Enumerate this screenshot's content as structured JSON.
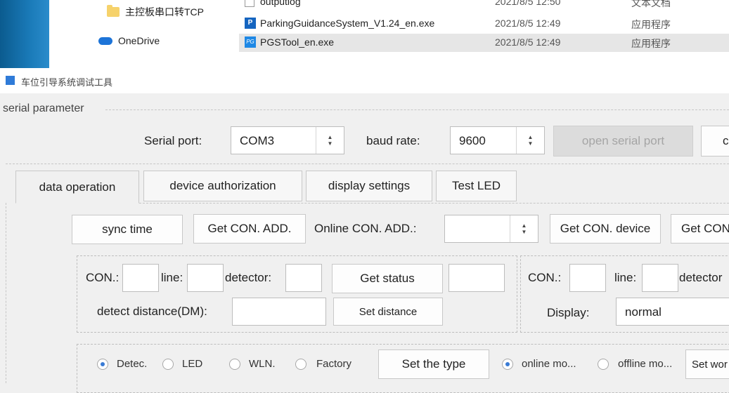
{
  "explorer": {
    "nav": [
      {
        "label": "主控板串口转TCP",
        "icon": "folder-icon"
      },
      {
        "label": "OneDrive",
        "icon": "cloud-icon"
      }
    ],
    "files": [
      {
        "name": "outputlog",
        "date": "2021/8/5 12:50",
        "type": "文本文档"
      },
      {
        "name": "ParkingGuidanceSystem_V1.24_en.exe",
        "date": "2021/8/5 12:49",
        "type": "应用程序"
      },
      {
        "name": "PGSTool_en.exe",
        "date": "2021/8/5 12:49",
        "type": "应用程序",
        "selected": true
      }
    ]
  },
  "app": {
    "title": "车位引导系统调试工具",
    "serial_group": "serial parameter",
    "serial_port_label": "Serial port:",
    "serial_port_value": "COM3",
    "baud_label": "baud rate:",
    "baud_value": "9600",
    "open_button": "open serial port",
    "next_button_fragment": "c"
  },
  "tabs": [
    {
      "label": "data operation",
      "active": true
    },
    {
      "label": "device authorization"
    },
    {
      "label": "display settings"
    },
    {
      "label": "Test LED"
    }
  ],
  "toolbar": {
    "sync_time": "sync time",
    "get_con_add": "Get CON. ADD.",
    "online_label": "Online CON. ADD.:",
    "online_value": "",
    "get_con_device": "Get CON. device",
    "get_con_fragment": "Get CON"
  },
  "left_box": {
    "con_label": "CON.:",
    "line_label": "line:",
    "detector_label": "detector:",
    "get_status": "Get status",
    "distance_label": "detect distance(DM):",
    "set_distance": "Set distance"
  },
  "right_box": {
    "con_label": "CON.:",
    "line_label": "line:",
    "detector_label": "detector",
    "display_label": "Display:",
    "display_value": "normal"
  },
  "bottom": {
    "radios": [
      {
        "label": "Detec.",
        "checked": true
      },
      {
        "label": "LED"
      },
      {
        "label": "WLN."
      },
      {
        "label": "Factory"
      }
    ],
    "set_type": "Set the type",
    "mode_radios": [
      {
        "label": "online mo...",
        "checked": true
      },
      {
        "label": "offline mo..."
      }
    ],
    "set_work_fragment": "Set wor"
  }
}
